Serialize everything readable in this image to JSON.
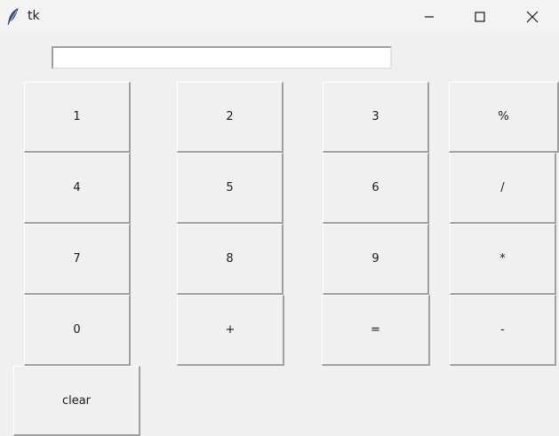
{
  "window": {
    "title": "tk",
    "icons": {
      "app": "feather-icon",
      "minimize": "minimize-icon",
      "maximize": "maximize-icon",
      "close": "close-icon"
    }
  },
  "entry": {
    "value": ""
  },
  "buttons": {
    "one": "1",
    "two": "2",
    "three": "3",
    "percent": "%",
    "four": "4",
    "five": "5",
    "six": "6",
    "divide": "/",
    "seven": "7",
    "eight": "8",
    "nine": "9",
    "multiply": "*",
    "zero": "0",
    "plus": "+",
    "equals": "=",
    "minus": "-",
    "clear": "clear"
  },
  "colors": {
    "background": "#f0f0f0",
    "titlebar": "#f3f3f3",
    "entry": "#ffffff",
    "feather": "#3d5a8a"
  }
}
